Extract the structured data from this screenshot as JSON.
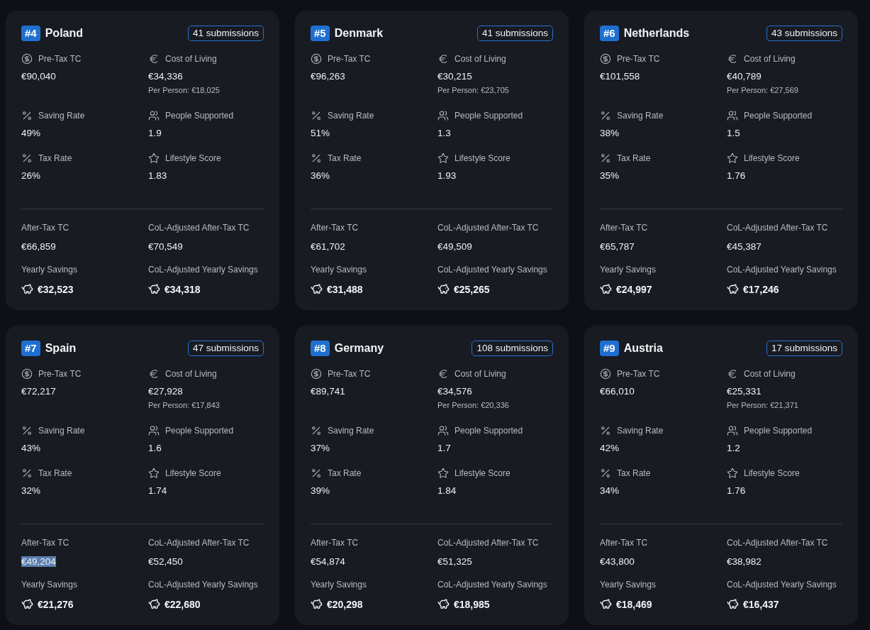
{
  "cards": [
    {
      "rank": "#4",
      "country": "Poland",
      "submissions": "41 submissions",
      "metrics": [
        {
          "kind": "dollar",
          "label": "Pre-Tax TC",
          "value": "€90,040"
        },
        {
          "kind": "euro",
          "label": "Cost of Living",
          "value": "€34,336",
          "note": "Per Person: €18,025"
        },
        {
          "kind": "percent",
          "label": "Saving Rate",
          "value": "49%"
        },
        {
          "kind": "people",
          "label": "People Supported",
          "value": "1.9"
        },
        {
          "kind": "percent",
          "label": "Tax Rate",
          "value": "26%"
        },
        {
          "kind": "star",
          "label": "Lifestyle Score",
          "value": "1.83"
        }
      ],
      "results": [
        {
          "kind": "plain",
          "label": "After-Tax TC",
          "value": "€66,859",
          "selected": false
        },
        {
          "kind": "plain",
          "label": "CoL-Adjusted After-Tax TC",
          "value": "€70,549",
          "selected": false
        },
        {
          "kind": "savings",
          "label": "Yearly Savings",
          "value": "€32,523",
          "selected": false
        },
        {
          "kind": "savings",
          "label": "CoL-Adjusted Yearly Savings",
          "value": "€34,318",
          "selected": false
        }
      ]
    },
    {
      "rank": "#5",
      "country": "Denmark",
      "submissions": "41 submissions",
      "metrics": [
        {
          "kind": "dollar",
          "label": "Pre-Tax TC",
          "value": "€96,263"
        },
        {
          "kind": "euro",
          "label": "Cost of Living",
          "value": "€30,215",
          "note": "Per Person: €23,705"
        },
        {
          "kind": "percent",
          "label": "Saving Rate",
          "value": "51%"
        },
        {
          "kind": "people",
          "label": "People Supported",
          "value": "1.3"
        },
        {
          "kind": "percent",
          "label": "Tax Rate",
          "value": "36%"
        },
        {
          "kind": "star",
          "label": "Lifestyle Score",
          "value": "1.93"
        }
      ],
      "results": [
        {
          "kind": "plain",
          "label": "After-Tax TC",
          "value": "€61,702",
          "selected": false
        },
        {
          "kind": "plain",
          "label": "CoL-Adjusted After-Tax TC",
          "value": "€49,509",
          "selected": false
        },
        {
          "kind": "savings",
          "label": "Yearly Savings",
          "value": "€31,488",
          "selected": false
        },
        {
          "kind": "savings",
          "label": "CoL-Adjusted Yearly Savings",
          "value": "€25,265",
          "selected": false
        }
      ]
    },
    {
      "rank": "#6",
      "country": "Netherlands",
      "submissions": "43 submissions",
      "metrics": [
        {
          "kind": "dollar",
          "label": "Pre-Tax TC",
          "value": "€101,558"
        },
        {
          "kind": "euro",
          "label": "Cost of Living",
          "value": "€40,789",
          "note": "Per Person: €27,569"
        },
        {
          "kind": "percent",
          "label": "Saving Rate",
          "value": "38%"
        },
        {
          "kind": "people",
          "label": "People Supported",
          "value": "1.5"
        },
        {
          "kind": "percent",
          "label": "Tax Rate",
          "value": "35%"
        },
        {
          "kind": "star",
          "label": "Lifestyle Score",
          "value": "1.76"
        }
      ],
      "results": [
        {
          "kind": "plain",
          "label": "After-Tax TC",
          "value": "€65,787",
          "selected": false
        },
        {
          "kind": "plain",
          "label": "CoL-Adjusted After-Tax TC",
          "value": "€45,387",
          "selected": false
        },
        {
          "kind": "savings",
          "label": "Yearly Savings",
          "value": "€24,997",
          "selected": false
        },
        {
          "kind": "savings",
          "label": "CoL-Adjusted Yearly Savings",
          "value": "€17,246",
          "selected": false
        }
      ]
    },
    {
      "rank": "#7",
      "country": "Spain",
      "submissions": "47 submissions",
      "metrics": [
        {
          "kind": "dollar",
          "label": "Pre-Tax TC",
          "value": "€72,217"
        },
        {
          "kind": "euro",
          "label": "Cost of Living",
          "value": "€27,928",
          "note": "Per Person: €17,843"
        },
        {
          "kind": "percent",
          "label": "Saving Rate",
          "value": "43%"
        },
        {
          "kind": "people",
          "label": "People Supported",
          "value": "1.6"
        },
        {
          "kind": "percent",
          "label": "Tax Rate",
          "value": "32%"
        },
        {
          "kind": "star",
          "label": "Lifestyle Score",
          "value": "1.74"
        }
      ],
      "results": [
        {
          "kind": "plain",
          "label": "After-Tax TC",
          "value": "€49,204",
          "selected": true
        },
        {
          "kind": "plain",
          "label": "CoL-Adjusted After-Tax TC",
          "value": "€52,450",
          "selected": false
        },
        {
          "kind": "savings",
          "label": "Yearly Savings",
          "value": "€21,276",
          "selected": false
        },
        {
          "kind": "savings",
          "label": "CoL-Adjusted Yearly Savings",
          "value": "€22,680",
          "selected": false
        }
      ]
    },
    {
      "rank": "#8",
      "country": "Germany",
      "submissions": "108 submissions",
      "metrics": [
        {
          "kind": "dollar",
          "label": "Pre-Tax TC",
          "value": "€89,741"
        },
        {
          "kind": "euro",
          "label": "Cost of Living",
          "value": "€34,576",
          "note": "Per Person: €20,336"
        },
        {
          "kind": "percent",
          "label": "Saving Rate",
          "value": "37%"
        },
        {
          "kind": "people",
          "label": "People Supported",
          "value": "1.7"
        },
        {
          "kind": "percent",
          "label": "Tax Rate",
          "value": "39%"
        },
        {
          "kind": "star",
          "label": "Lifestyle Score",
          "value": "1.84"
        }
      ],
      "results": [
        {
          "kind": "plain",
          "label": "After-Tax TC",
          "value": "€54,874",
          "selected": false
        },
        {
          "kind": "plain",
          "label": "CoL-Adjusted After-Tax TC",
          "value": "€51,325",
          "selected": false
        },
        {
          "kind": "savings",
          "label": "Yearly Savings",
          "value": "€20,298",
          "selected": false
        },
        {
          "kind": "savings",
          "label": "CoL-Adjusted Yearly Savings",
          "value": "€18,985",
          "selected": false
        }
      ]
    },
    {
      "rank": "#9",
      "country": "Austria",
      "submissions": "17 submissions",
      "metrics": [
        {
          "kind": "dollar",
          "label": "Pre-Tax TC",
          "value": "€66,010"
        },
        {
          "kind": "euro",
          "label": "Cost of Living",
          "value": "€25,331",
          "note": "Per Person: €21,371"
        },
        {
          "kind": "percent",
          "label": "Saving Rate",
          "value": "42%"
        },
        {
          "kind": "people",
          "label": "People Supported",
          "value": "1.2"
        },
        {
          "kind": "percent",
          "label": "Tax Rate",
          "value": "34%"
        },
        {
          "kind": "star",
          "label": "Lifestyle Score",
          "value": "1.76"
        }
      ],
      "results": [
        {
          "kind": "plain",
          "label": "After-Tax TC",
          "value": "€43,800",
          "selected": false
        },
        {
          "kind": "plain",
          "label": "CoL-Adjusted After-Tax TC",
          "value": "€38,982",
          "selected": false
        },
        {
          "kind": "savings",
          "label": "Yearly Savings",
          "value": "€18,469",
          "selected": false
        },
        {
          "kind": "savings",
          "label": "CoL-Adjusted Yearly Savings",
          "value": "€16,437",
          "selected": false
        }
      ]
    }
  ]
}
